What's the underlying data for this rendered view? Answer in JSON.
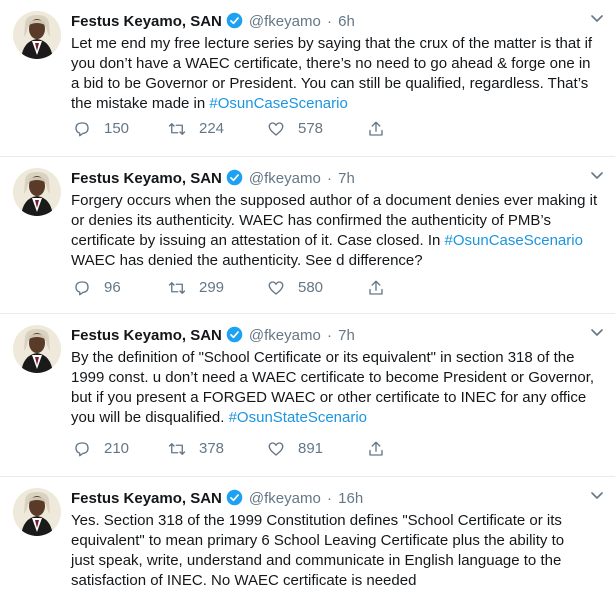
{
  "tweets": [
    {
      "name": "Festus Keyamo, SAN",
      "handle": "@fkeyamo",
      "dot": "·",
      "time": "6h",
      "lines": [
        "Let me end my free lecture series by saying that the crux of the matter is that if",
        "you don’t have a WAEC certificate, there’s no need to go ahead & forge one in",
        "a bid to be Governor or President. You can still be qualified, regardless. That’s",
        "the mistake made in "
      ],
      "hashtag": "#OsunCaseScenario",
      "replies": "150",
      "retweets": "224",
      "likes": "578"
    },
    {
      "name": "Festus Keyamo, SAN",
      "handle": "@fkeyamo",
      "dot": "·",
      "time": "7h",
      "lines": [
        "Forgery occurs when the supposed author of a document denies ever making it",
        "or denies its authenticity. WAEC has confirmed the authenticity of PMB’s",
        "certificate by issuing an attestation of it. Case closed. In ",
        "WAEC has denied the authenticity. See d difference?"
      ],
      "hashtag": "#OsunCaseScenario",
      "replies": "96",
      "retweets": "299",
      "likes": "580"
    },
    {
      "name": "Festus Keyamo, SAN",
      "handle": "@fkeyamo",
      "dot": "·",
      "time": "7h",
      "lines": [
        "By the definition of \"School Certificate or its equivalent\" in section 318 of the",
        "1999 const. u don’t need a WAEC certificate to become President or Governor,",
        "but if you present a FORGED WAEC or other certificate to INEC for any office",
        "you will be disqualified. "
      ],
      "hashtag": "#OsunStateScenario",
      "replies": "210",
      "retweets": "378",
      "likes": "891"
    },
    {
      "name": "Festus Keyamo, SAN",
      "handle": "@fkeyamo",
      "dot": "·",
      "time": "16h",
      "lines": [
        "Yes. Section 318 of the 1999 Constitution defines \"School Certificate or its",
        "equivalent\" to mean primary 6 School Leaving Certificate plus the ability to",
        "just speak, write, understand and communicate in English language to the",
        "satisfaction of INEC. No WAEC certificate is needed"
      ]
    }
  ],
  "icons": {
    "reply": "reply-icon",
    "retweet": "retweet-icon",
    "like": "heart-icon",
    "share": "share-icon",
    "verified": "verified-badge-icon",
    "caret": "chevron-down-icon"
  },
  "colors": {
    "link": "#1b95e0",
    "muted": "#657786",
    "verified": "#1da1f2",
    "divider": "#e6ecf0"
  }
}
